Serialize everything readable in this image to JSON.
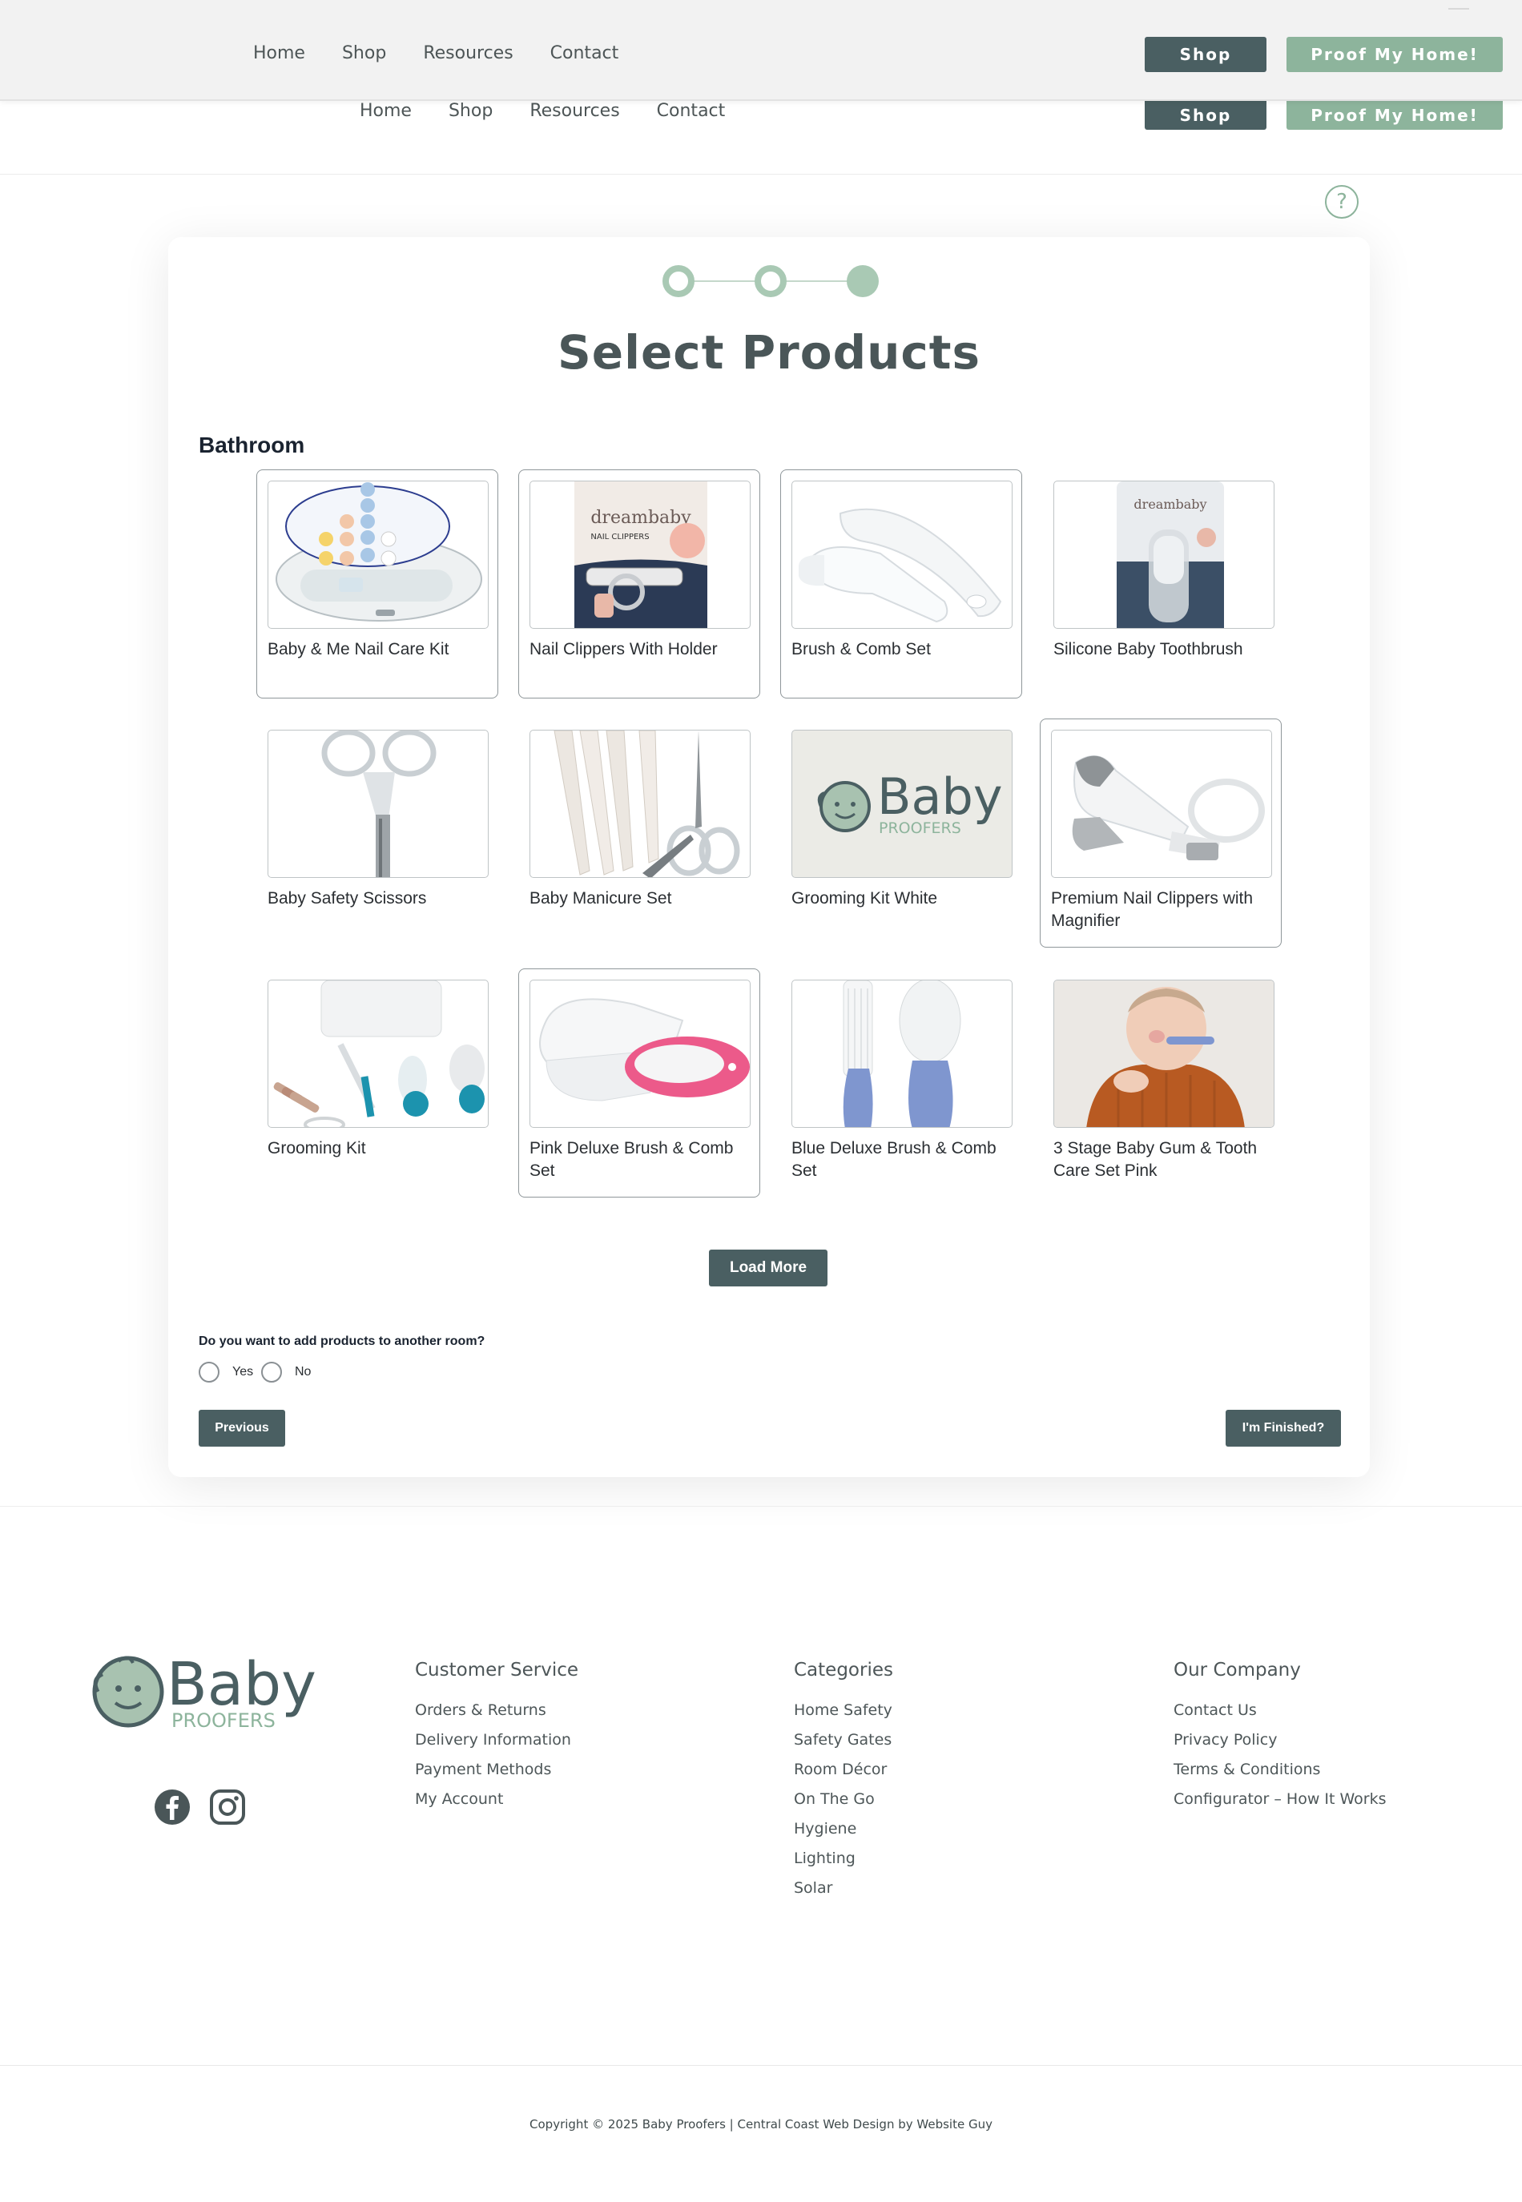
{
  "nav": {
    "home": "Home",
    "shop": "Shop",
    "resources": "Resources",
    "contact": "Contact"
  },
  "header_buttons": {
    "shop": "Shop",
    "proof": "Proof My Home!"
  },
  "help_icon": "question-mark-icon",
  "stepper": {
    "steps": 3,
    "current": 3
  },
  "page_title": "Select Products",
  "room_title": "Bathroom",
  "products": [
    {
      "name": "Baby & Me Nail Care Kit",
      "selected": true
    },
    {
      "name": "Nail Clippers With Holder",
      "selected": true
    },
    {
      "name": "Brush & Comb Set",
      "selected": true
    },
    {
      "name": "Silicone Baby Toothbrush",
      "selected": false
    },
    {
      "name": "Baby Safety Scissors",
      "selected": false
    },
    {
      "name": "Baby Manicure Set",
      "selected": false
    },
    {
      "name": "Grooming Kit White",
      "selected": false
    },
    {
      "name": "Premium Nail Clippers with Magnifier",
      "selected": true
    },
    {
      "name": "Grooming Kit",
      "selected": false
    },
    {
      "name": "Pink Deluxe Brush & Comb Set",
      "selected": true
    },
    {
      "name": "Blue Deluxe Brush & Comb Set",
      "selected": false
    },
    {
      "name": "3 Stage Baby Gum & Tooth Care Set Pink",
      "selected": false
    }
  ],
  "product_image_text": {
    "brand": "dreambaby",
    "nail_clippers_label": "NAIL CLIPPERS",
    "logo_baby": "Baby",
    "logo_proofers": "PROOFERS"
  },
  "load_more": "Load More",
  "question": "Do you want to add products to another room?",
  "answers": {
    "yes": "Yes",
    "no": "No"
  },
  "buttons": {
    "previous": "Previous",
    "finished": "I'm Finished?"
  },
  "footer": {
    "logo_baby": "Baby",
    "logo_proofers": "PROOFERS",
    "social": [
      "facebook-icon",
      "instagram-icon"
    ],
    "columns": [
      {
        "title": "Customer Service",
        "links": [
          "Orders & Returns",
          "Delivery Information",
          "Payment Methods",
          "My Account"
        ]
      },
      {
        "title": "Categories",
        "links": [
          "Home Safety",
          "Safety Gates",
          "Room Décor",
          "On The Go",
          "Hygiene",
          "Lighting",
          "Solar"
        ]
      },
      {
        "title": "Our Company",
        "links": [
          "Contact Us",
          "Privacy Policy",
          "Terms & Conditions",
          "Configurator – How It Works"
        ]
      }
    ],
    "copyright": "Copyright © 2025 Baby Proofers | Central Coast Web Design by Website Guy"
  },
  "colors": {
    "accent_dark": "#4a5f62",
    "accent_green": "#8db49c",
    "step_green": "#a9c9b4"
  }
}
